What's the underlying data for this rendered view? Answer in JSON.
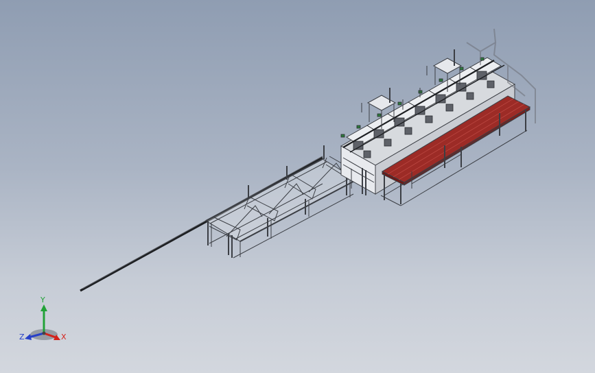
{
  "app": {
    "view": "isometric-assembly-view"
  },
  "colors": {
    "background_top": "#8f9db2",
    "background_bottom": "#d3d7de",
    "frame": "#e6e8ec",
    "frame_edge": "#3b3e44",
    "conveyor_red": "#9c2b26",
    "conveyor_red_dark": "#6e1815",
    "bar": "#1d1f22",
    "accent_green": "#2d7a3c",
    "axis_x": "#d4221b",
    "axis_y": "#22a238",
    "axis_z": "#2740c8"
  },
  "triad": {
    "x_label": "X",
    "y_label": "Y",
    "z_label": "Z"
  }
}
